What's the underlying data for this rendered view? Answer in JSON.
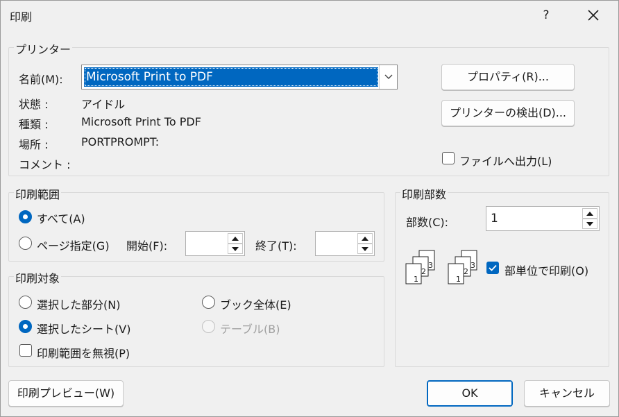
{
  "window": {
    "title": "印刷",
    "help": "?",
    "close_icon": "close-icon"
  },
  "printer": {
    "group_label": "プリンター",
    "name_label": "名前(M):",
    "name_value": "Microsoft Print to PDF",
    "status_label": "状態 :",
    "status_value": "アイドル",
    "type_label": "種類 :",
    "type_value": "Microsoft Print To PDF",
    "location_label": "場所 :",
    "location_value": "PORTPROMPT:",
    "comment_label": "コメント :",
    "comment_value": "",
    "properties_button": "プロパティ(R)...",
    "find_printer_button": "プリンターの検出(D)...",
    "print_to_file_label": "ファイルへ出力(L)",
    "print_to_file_checked": false
  },
  "range": {
    "group_label": "印刷範囲",
    "all_label": "すべて(A)",
    "all_selected": true,
    "pages_label": "ページ指定(G)",
    "from_label": "開始(F):",
    "from_value": "",
    "to_label": "終了(T):",
    "to_value": ""
  },
  "target": {
    "group_label": "印刷対象",
    "selection_label": "選択した部分(N)",
    "workbook_label": "ブック全体(E)",
    "active_sheets_label": "選択したシート(V)",
    "active_sheets_selected": true,
    "table_label": "テーブル(B)",
    "table_disabled": true,
    "ignore_areas_label": "印刷範囲を無視(P)",
    "ignore_areas_checked": false
  },
  "copies": {
    "group_label": "印刷部数",
    "count_label": "部数(C):",
    "count_value": "1",
    "collate_label": "部単位で印刷(O)",
    "collate_checked": true,
    "collate_icon_1": "collate-pages-icon",
    "collate_icon_2": "collate-pages-icon"
  },
  "footer": {
    "preview_button": "印刷プレビュー(W)",
    "ok_button": "OK",
    "cancel_button": "キャンセル"
  },
  "colors": {
    "accent": "#0067c0",
    "background": "#f0f0f0"
  }
}
